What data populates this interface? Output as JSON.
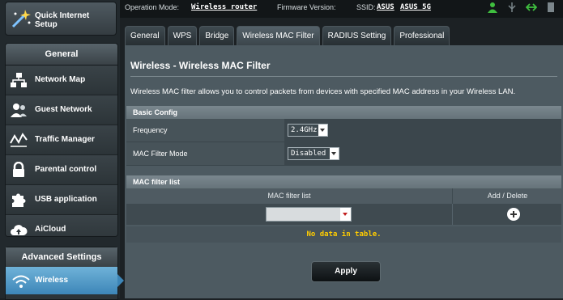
{
  "status_bar": {
    "operation_mode_label": "Operation Mode:",
    "operation_mode_value": "Wireless router",
    "firmware_label": "Firmware Version:",
    "ssid_label": "SSID:",
    "ssid_values": [
      "ASUS",
      "ASUS_5G"
    ]
  },
  "sidebar": {
    "quick_setup": "Quick Internet Setup",
    "general_header": "General",
    "items": [
      {
        "label": "Network Map",
        "icon": "network-map-icon"
      },
      {
        "label": "Guest Network",
        "icon": "guest-network-icon"
      },
      {
        "label": "Traffic Manager",
        "icon": "traffic-manager-icon"
      },
      {
        "label": "Parental control",
        "icon": "lock-icon"
      },
      {
        "label": "USB application",
        "icon": "puzzle-icon"
      },
      {
        "label": "AiCloud",
        "icon": "cloud-icon"
      }
    ],
    "advanced_header": "Advanced Settings",
    "active_item": "Wireless"
  },
  "tabs": [
    "General",
    "WPS",
    "Bridge",
    "Wireless MAC Filter",
    "RADIUS Setting",
    "Professional"
  ],
  "active_tab": "Wireless MAC Filter",
  "page": {
    "title": "Wireless - Wireless MAC Filter",
    "description": "Wireless MAC filter allows you to control packets from devices with specified MAC address in your Wireless LAN."
  },
  "basic_config": {
    "header": "Basic Config",
    "frequency_label": "Frequency",
    "frequency_value": "2.4GHz",
    "mode_label": "MAC Filter Mode",
    "mode_value": "Disabled"
  },
  "mac_list": {
    "header": "MAC filter list",
    "col_list": "MAC filter list",
    "col_action": "Add / Delete",
    "empty_text": "No data in table."
  },
  "apply_label": "Apply",
  "colors": {
    "accent_blue": "#3d86b8",
    "empty_text": "#ffcc00",
    "status_green": "#3fbf3f"
  }
}
